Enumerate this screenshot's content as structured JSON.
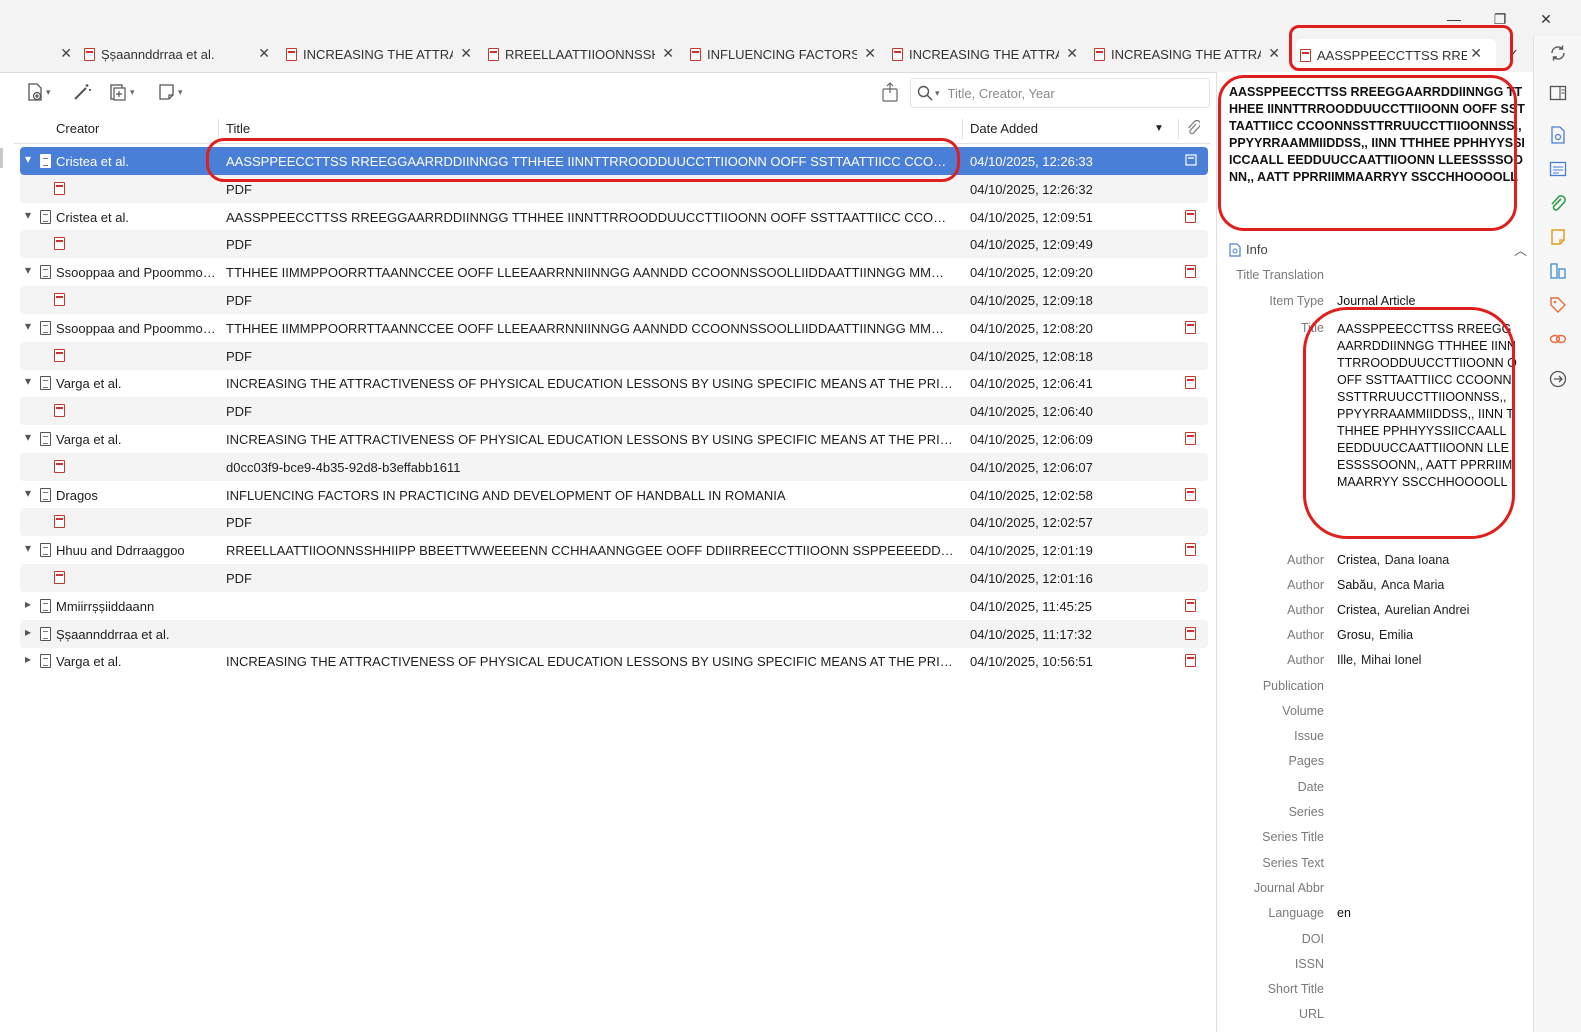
{
  "window": {
    "minimize_glyph": "—",
    "restore_glyph": "❐",
    "close_glyph": "✕"
  },
  "tabs": [
    {
      "label": "Șșaannddrraa et al.",
      "type": "library"
    },
    {
      "label": "INCREASING THE ATTRACTIVENESS OF PHYSICAL EDUCATION",
      "type": "pdf"
    },
    {
      "label": "RREELLAATTIIOONNSSHHIIPP",
      "type": "pdf"
    },
    {
      "label": "INFLUENCING FACTORS IN PRACTICING",
      "type": "pdf"
    },
    {
      "label": "INCREASING THE ATTRACTIVENESS",
      "type": "pdf"
    },
    {
      "label": "INCREASING THE ATTRACTIVENESS",
      "type": "pdf"
    },
    {
      "label": "AASSPPEECCTTSS RREEGGAARRDDIINNGG",
      "type": "pdf",
      "active": true
    }
  ],
  "tab_close_glyph": "✕",
  "tabs_overflow_glyph": "✓",
  "toolbar": {
    "icons": [
      "new-item-icon",
      "magic-wand-icon",
      "add-attachment-icon",
      "new-note-icon"
    ],
    "search_placeholder": "Title, Creator, Year"
  },
  "columns": {
    "creator": "Creator",
    "title": "Title",
    "date_added": "Date Added"
  },
  "rows": [
    {
      "kind": "parent",
      "creator": "Cristea et al.",
      "title": "AASSPPEECCTTSS RREEGGAARRDDIINNGG TTHHEE IINNTTRROODDUUCCTTIIOONN OOFF SSTTAATTIICC CCOONNSSTTRRUUCCTTIIOONNSS",
      "date": "04/10/2025, 12:26:33",
      "selected": true
    },
    {
      "kind": "child",
      "title": "PDF",
      "date": "04/10/2025, 12:26:32"
    },
    {
      "kind": "parent",
      "creator": "Cristea et al.",
      "title": "AASSPPEECCTTSS RREEGGAARRDDIINNGG TTHHEE IINNTTRROODDUUCCTTIIOONN OOFF SSTTAATTIICC CCOONNSSTTRRUUCCTTIIOONNSS",
      "date": "04/10/2025, 12:09:51"
    },
    {
      "kind": "child",
      "title": "PDF",
      "date": "04/10/2025, 12:09:49"
    },
    {
      "kind": "parent",
      "creator": "Ssooppaa and Ppoommoorrttaa",
      "title": "TTHHEE IIMMPPOORRTTAANNCCEE OOFF LLEEAARRNNIINNGG AANNDD CCOONNSSOOLLIIDDAATTIINNGG MMOOTTOORR SSKKIILLLLSS",
      "date": "04/10/2025, 12:09:20"
    },
    {
      "kind": "child",
      "title": "PDF",
      "date": "04/10/2025, 12:09:18"
    },
    {
      "kind": "parent",
      "creator": "Ssooppaa and Ppoommoorrttaa",
      "title": "TTHHEE IIMMPPOORRTTAANNCCEE OOFF LLEEAARRNNIINNGG AANNDD CCOONNSSOOLLIIDDAATTIINNGG MMOOTTOORR SSKKIILLLLSS",
      "date": "04/10/2025, 12:08:20"
    },
    {
      "kind": "child",
      "title": "PDF",
      "date": "04/10/2025, 12:08:18"
    },
    {
      "kind": "parent",
      "creator": "Varga et al.",
      "title": "INCREASING THE ATTRACTIVENESS OF PHYSICAL EDUCATION LESSONS BY USING SPECIFIC MEANS AT THE PRIMARY CYCLE",
      "date": "04/10/2025, 12:06:41"
    },
    {
      "kind": "child",
      "title": "PDF",
      "date": "04/10/2025, 12:06:40"
    },
    {
      "kind": "parent",
      "creator": "Varga et al.",
      "title": "INCREASING THE ATTRACTIVENESS OF PHYSICAL EDUCATION LESSONS BY USING SPECIFIC MEANS AT THE PRIMARY CYCLE",
      "date": "04/10/2025, 12:06:09"
    },
    {
      "kind": "child",
      "title": "d0cc03f9-bce9-4b35-92d8-b3effabb1611",
      "date": "04/10/2025, 12:06:07"
    },
    {
      "kind": "parent",
      "creator": "Dragos",
      "title": "INFLUENCING FACTORS IN PRACTICING AND DEVELOPMENT OF HANDBALL IN ROMANIA",
      "date": "04/10/2025, 12:02:58"
    },
    {
      "kind": "child",
      "title": "PDF",
      "date": "04/10/2025, 12:02:57"
    },
    {
      "kind": "parent",
      "creator": "Hhuu and Ddrraaggoo",
      "title": "RREELLAATTIIOONNSSHHIIPP BBEETTWWEEEENN CCHHAANNGGEE OOFF DDIIRREECCTTIIOONN SSPPEEEEDD,, LLIINNEEAARR SSPPRRIINNTT",
      "date": "04/10/2025, 12:01:19"
    },
    {
      "kind": "child",
      "title": "PDF",
      "date": "04/10/2025, 12:01:16"
    },
    {
      "kind": "collapsed",
      "creator": "Mmiirrșșiiddaann",
      "title": "",
      "date": "04/10/2025, 11:45:25"
    },
    {
      "kind": "collapsed",
      "creator": "Șșaannddrraa et al.",
      "title": "",
      "date": "04/10/2025, 11:17:32"
    },
    {
      "kind": "collapsed",
      "creator": "Varga et al.",
      "title": "INCREASING THE ATTRACTIVENESS OF PHYSICAL EDUCATION LESSONS BY USING SPECIFIC MEANS AT THE PRIMARY CYCLE",
      "date": "04/10/2025, 10:56:51"
    }
  ],
  "pane": {
    "header_title": "AASSPPEECCTTSS RREEGGAARRDDIINNGG TTHHEE IINNTTRROODDUUCCTTIIOONN OOFF SSTTAATTIICC CCOONNSSTTRRUUCCTTIIOONNSS,, PPYYRRAAMMIIDDSS,, IINN TTHHEE PPHHYYSSIICCAALL EEDDUUCCAATTIIOONN LLEESSSSOONN,, AATT PPRRIIMMAARRYY SSCCHHOOOOLL",
    "info_label": "Info",
    "title_translation_label": "Title Translation",
    "item_type_label": "Item Type",
    "item_type_value": "Journal Article",
    "title_label": "Title",
    "title_value": "AASSPPEECCTTSS RREEGGAARRDDIINNGG TTHHEE IINNTTRROODDUUCCTTIIOONN OOFF SSTTAATTIICC CCOONNSSTTRRUUCCTTIIOONNSS,, PPYYRRAAMMIIDDSS,, IINN TTHHEE PPHHYYSSIICCAALL EEDDUUCCAATTIIOONN LLEESSSSOONN,, AATT PPRRIIMMAARRYY SSCCHHOOOOLL",
    "authors": [
      {
        "label": "Author",
        "last": "Cristea",
        "first": "Dana Ioana"
      },
      {
        "label": "Author",
        "last": "Sabău",
        "first": "Anca Maria"
      },
      {
        "label": "Author",
        "last": "Cristea",
        "first": "Aurelian Andrei"
      },
      {
        "label": "Author",
        "last": "Grosu",
        "first": "Emilia"
      },
      {
        "label": "Author",
        "last": "Ille",
        "first": "Mihai Ionel"
      }
    ],
    "fields": [
      {
        "label": "Publication",
        "value": ""
      },
      {
        "label": "Volume",
        "value": ""
      },
      {
        "label": "Issue",
        "value": ""
      },
      {
        "label": "Pages",
        "value": ""
      },
      {
        "label": "Date",
        "value": ""
      },
      {
        "label": "Series",
        "value": ""
      },
      {
        "label": "Series Title",
        "value": ""
      },
      {
        "label": "Series Text",
        "value": ""
      },
      {
        "label": "Journal Abbr",
        "value": ""
      },
      {
        "label": "Language",
        "value": "en"
      },
      {
        "label": "DOI",
        "value": ""
      },
      {
        "label": "ISSN",
        "value": ""
      },
      {
        "label": "Short Title",
        "value": ""
      },
      {
        "label": "URL",
        "value": ""
      }
    ]
  },
  "colors": {
    "accent": "#4a7fd8",
    "annotation": "#e01e1e",
    "pdf": "#c0392b"
  }
}
